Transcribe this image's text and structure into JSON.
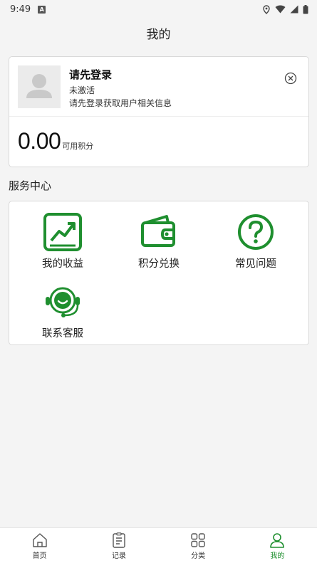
{
  "status_bar": {
    "time": "9:49",
    "badge": "A"
  },
  "header": {
    "title": "我的"
  },
  "profile": {
    "title": "请先登录",
    "status": "未激活",
    "hint": "请先登录获取用户相关信息",
    "points_value": "0.00",
    "points_label": "可用积分"
  },
  "services": {
    "section_title": "服务中心",
    "items": [
      {
        "label": "我的收益",
        "icon": "earnings-chart-icon"
      },
      {
        "label": "积分兑换",
        "icon": "wallet-icon"
      },
      {
        "label": "常见问题",
        "icon": "question-circle-icon"
      },
      {
        "label": "联系客服",
        "icon": "headset-icon"
      }
    ]
  },
  "nav": {
    "items": [
      {
        "label": "首页",
        "icon": "home-icon"
      },
      {
        "label": "记录",
        "icon": "record-icon"
      },
      {
        "label": "分类",
        "icon": "category-icon"
      },
      {
        "label": "我的",
        "icon": "user-icon"
      }
    ]
  },
  "colors": {
    "accent": "#1f8f2f",
    "background": "#f4f4f4"
  }
}
